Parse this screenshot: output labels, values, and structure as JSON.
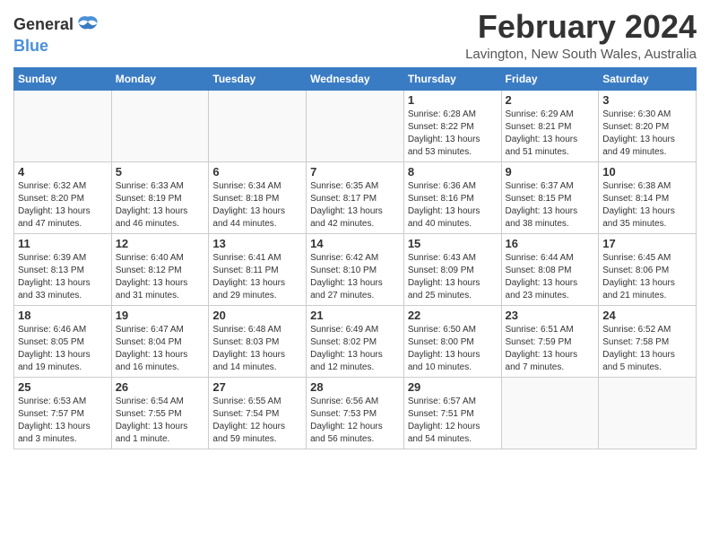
{
  "logo": {
    "text_general": "General",
    "text_blue": "Blue"
  },
  "title": {
    "month_year": "February 2024",
    "location": "Lavington, New South Wales, Australia"
  },
  "headers": [
    "Sunday",
    "Monday",
    "Tuesday",
    "Wednesday",
    "Thursday",
    "Friday",
    "Saturday"
  ],
  "weeks": [
    [
      {
        "day": "",
        "info": ""
      },
      {
        "day": "",
        "info": ""
      },
      {
        "day": "",
        "info": ""
      },
      {
        "day": "",
        "info": ""
      },
      {
        "day": "1",
        "info": "Sunrise: 6:28 AM\nSunset: 8:22 PM\nDaylight: 13 hours\nand 53 minutes."
      },
      {
        "day": "2",
        "info": "Sunrise: 6:29 AM\nSunset: 8:21 PM\nDaylight: 13 hours\nand 51 minutes."
      },
      {
        "day": "3",
        "info": "Sunrise: 6:30 AM\nSunset: 8:20 PM\nDaylight: 13 hours\nand 49 minutes."
      }
    ],
    [
      {
        "day": "4",
        "info": "Sunrise: 6:32 AM\nSunset: 8:20 PM\nDaylight: 13 hours\nand 47 minutes."
      },
      {
        "day": "5",
        "info": "Sunrise: 6:33 AM\nSunset: 8:19 PM\nDaylight: 13 hours\nand 46 minutes."
      },
      {
        "day": "6",
        "info": "Sunrise: 6:34 AM\nSunset: 8:18 PM\nDaylight: 13 hours\nand 44 minutes."
      },
      {
        "day": "7",
        "info": "Sunrise: 6:35 AM\nSunset: 8:17 PM\nDaylight: 13 hours\nand 42 minutes."
      },
      {
        "day": "8",
        "info": "Sunrise: 6:36 AM\nSunset: 8:16 PM\nDaylight: 13 hours\nand 40 minutes."
      },
      {
        "day": "9",
        "info": "Sunrise: 6:37 AM\nSunset: 8:15 PM\nDaylight: 13 hours\nand 38 minutes."
      },
      {
        "day": "10",
        "info": "Sunrise: 6:38 AM\nSunset: 8:14 PM\nDaylight: 13 hours\nand 35 minutes."
      }
    ],
    [
      {
        "day": "11",
        "info": "Sunrise: 6:39 AM\nSunset: 8:13 PM\nDaylight: 13 hours\nand 33 minutes."
      },
      {
        "day": "12",
        "info": "Sunrise: 6:40 AM\nSunset: 8:12 PM\nDaylight: 13 hours\nand 31 minutes."
      },
      {
        "day": "13",
        "info": "Sunrise: 6:41 AM\nSunset: 8:11 PM\nDaylight: 13 hours\nand 29 minutes."
      },
      {
        "day": "14",
        "info": "Sunrise: 6:42 AM\nSunset: 8:10 PM\nDaylight: 13 hours\nand 27 minutes."
      },
      {
        "day": "15",
        "info": "Sunrise: 6:43 AM\nSunset: 8:09 PM\nDaylight: 13 hours\nand 25 minutes."
      },
      {
        "day": "16",
        "info": "Sunrise: 6:44 AM\nSunset: 8:08 PM\nDaylight: 13 hours\nand 23 minutes."
      },
      {
        "day": "17",
        "info": "Sunrise: 6:45 AM\nSunset: 8:06 PM\nDaylight: 13 hours\nand 21 minutes."
      }
    ],
    [
      {
        "day": "18",
        "info": "Sunrise: 6:46 AM\nSunset: 8:05 PM\nDaylight: 13 hours\nand 19 minutes."
      },
      {
        "day": "19",
        "info": "Sunrise: 6:47 AM\nSunset: 8:04 PM\nDaylight: 13 hours\nand 16 minutes."
      },
      {
        "day": "20",
        "info": "Sunrise: 6:48 AM\nSunset: 8:03 PM\nDaylight: 13 hours\nand 14 minutes."
      },
      {
        "day": "21",
        "info": "Sunrise: 6:49 AM\nSunset: 8:02 PM\nDaylight: 13 hours\nand 12 minutes."
      },
      {
        "day": "22",
        "info": "Sunrise: 6:50 AM\nSunset: 8:00 PM\nDaylight: 13 hours\nand 10 minutes."
      },
      {
        "day": "23",
        "info": "Sunrise: 6:51 AM\nSunset: 7:59 PM\nDaylight: 13 hours\nand 7 minutes."
      },
      {
        "day": "24",
        "info": "Sunrise: 6:52 AM\nSunset: 7:58 PM\nDaylight: 13 hours\nand 5 minutes."
      }
    ],
    [
      {
        "day": "25",
        "info": "Sunrise: 6:53 AM\nSunset: 7:57 PM\nDaylight: 13 hours\nand 3 minutes."
      },
      {
        "day": "26",
        "info": "Sunrise: 6:54 AM\nSunset: 7:55 PM\nDaylight: 13 hours\nand 1 minute."
      },
      {
        "day": "27",
        "info": "Sunrise: 6:55 AM\nSunset: 7:54 PM\nDaylight: 12 hours\nand 59 minutes."
      },
      {
        "day": "28",
        "info": "Sunrise: 6:56 AM\nSunset: 7:53 PM\nDaylight: 12 hours\nand 56 minutes."
      },
      {
        "day": "29",
        "info": "Sunrise: 6:57 AM\nSunset: 7:51 PM\nDaylight: 12 hours\nand 54 minutes."
      },
      {
        "day": "",
        "info": ""
      },
      {
        "day": "",
        "info": ""
      }
    ]
  ]
}
